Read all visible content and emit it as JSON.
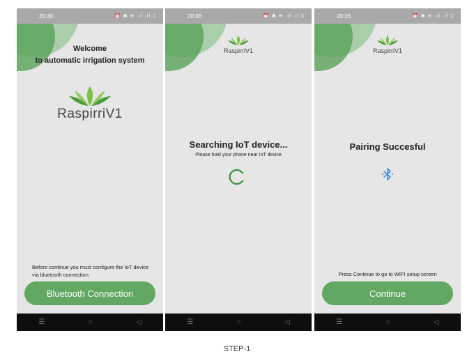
{
  "status": {
    "time_1": "20:30",
    "time_2": "20:36",
    "time_3": "20:36",
    "icons_label": "⏰ ✱ ≋ .ıl .ıl ▯"
  },
  "nav": {
    "menu": "☰",
    "home": "○",
    "back": "◁"
  },
  "screen1": {
    "welcome_line1": "Welcome",
    "welcome_line2": "to automatic irrigation system",
    "brand": "RaspirriV1",
    "instruction": "Before continue you must configure the IoT device via bluetooth connection",
    "button": "Bluetooth Connection"
  },
  "screen2": {
    "brand": "RaspirriV1",
    "heading": "Searching IoT device...",
    "subtext": "Please hold your phone near IoT device"
  },
  "screen3": {
    "brand": "RaspirriV1",
    "heading": "Pairing Succesful",
    "instruction": "Press Continue to go to WIFI setup screen",
    "button": "Continue"
  },
  "caption": "STEP-1",
  "colors": {
    "accent_green": "#62a762",
    "bluetooth_blue": "#3d8fd6",
    "spinner_green": "#3c8a3c"
  }
}
